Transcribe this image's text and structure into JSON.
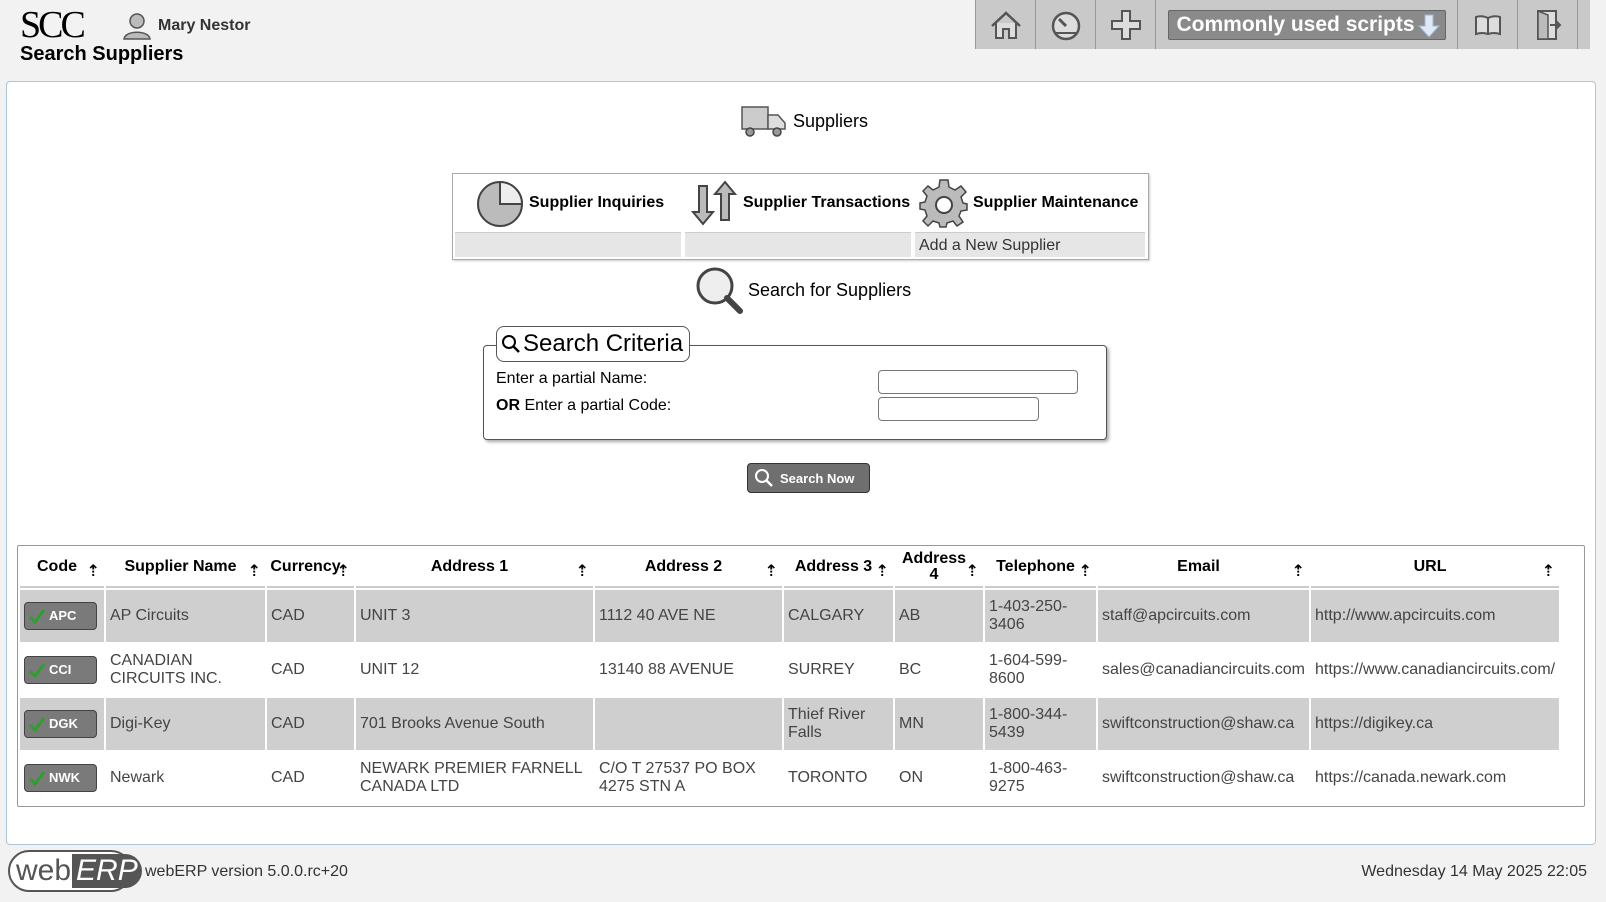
{
  "header": {
    "logo": "SCC",
    "user_name": "Mary Nestor",
    "page_title": "Search Suppliers",
    "scripts_label": "Commonly used scripts"
  },
  "toolbar_icons": [
    "home-icon",
    "dashboard-icon",
    "plus-icon",
    "manual-icon",
    "logout-icon"
  ],
  "section": {
    "title": "Suppliers",
    "menu": {
      "inquiries": {
        "title": "Supplier Inquiries",
        "items": [
          ""
        ]
      },
      "transactions": {
        "title": "Supplier Transactions",
        "items": [
          ""
        ]
      },
      "maintenance": {
        "title": "Supplier Maintenance",
        "items": [
          "Add a New Supplier"
        ]
      }
    },
    "search_title": "Search for Suppliers"
  },
  "search": {
    "legend": "Search Criteria",
    "name_label": "Enter a partial Name:",
    "code_label_bold": "OR",
    "code_label": "Enter a partial Code:",
    "name_value": "",
    "code_value": "",
    "button_label": "Search Now"
  },
  "table": {
    "columns": [
      "Code",
      "Supplier Name",
      "Currency",
      "Address 1",
      "Address 2",
      "Address 3",
      "Address 4",
      "Telephone",
      "Email",
      "URL"
    ],
    "rows": [
      {
        "code": "APC",
        "name": "AP Circuits",
        "currency": "CAD",
        "addr1": "UNIT 3",
        "addr2": "1112 40 AVE NE",
        "addr3": "CALGARY",
        "addr4": "AB",
        "phone": "1-403-250-3406",
        "email": "staff@apcircuits.com",
        "url": "http://www.apcircuits.com"
      },
      {
        "code": "CCI",
        "name": "CANADIAN CIRCUITS INC.",
        "currency": "CAD",
        "addr1": "UNIT 12",
        "addr2": "13140 88 AVENUE",
        "addr3": "SURREY",
        "addr4": "BC",
        "phone": "1-604-599-8600",
        "email": "sales@canadiancircuits.com",
        "url": "https://www.canadiancircuits.com/"
      },
      {
        "code": "DGK",
        "name": "Digi-Key",
        "currency": "CAD",
        "addr1": "701 Brooks Avenue South",
        "addr2": "",
        "addr3": "Thief River Falls",
        "addr4": "MN",
        "phone": "1-800-344-5439",
        "email": "swiftconstruction@shaw.ca",
        "url": "https://digikey.ca"
      },
      {
        "code": "NWK",
        "name": "Newark",
        "currency": "CAD",
        "addr1": "NEWARK PREMIER FARNELL CANADA LTD",
        "addr2": "C/O T 27537 PO BOX 4275 STN A",
        "addr3": "TORONTO",
        "addr4": "ON",
        "phone": "1-800-463-9275",
        "email": "swiftconstruction@shaw.ca",
        "url": "https://canada.newark.com"
      }
    ]
  },
  "footer": {
    "logo_web": "web",
    "logo_erp": "ERP",
    "version": "webERP version 5.0.0.rc+20",
    "datetime": "Wednesday 14 May 2025 22:05"
  }
}
